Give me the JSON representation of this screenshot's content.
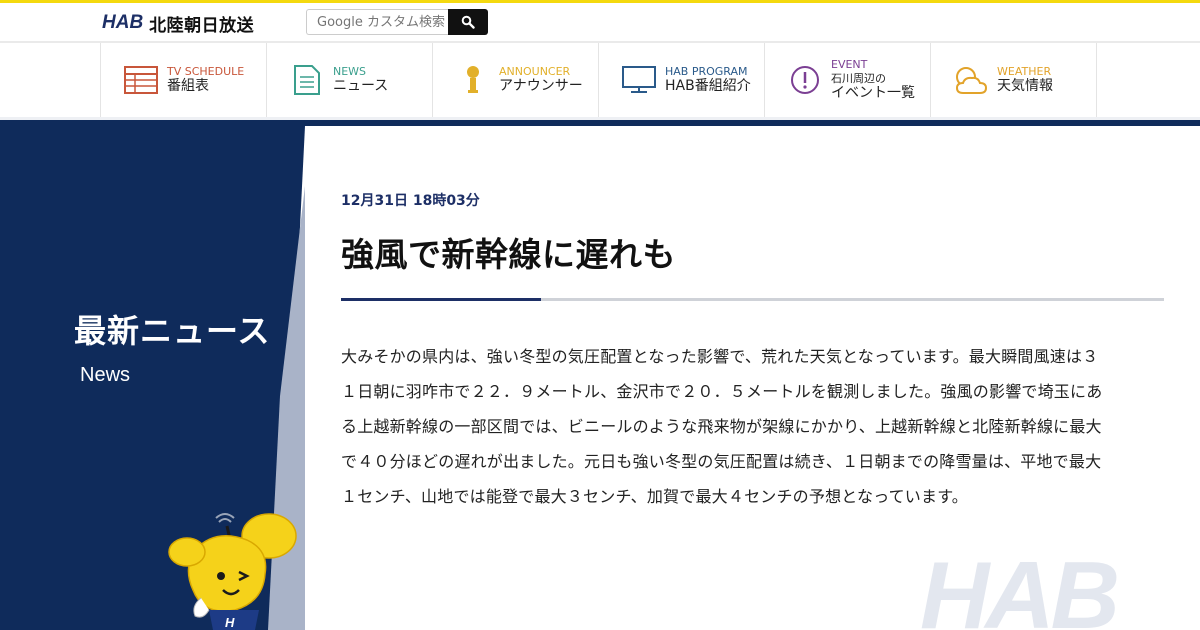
{
  "header": {
    "logo_mark": "HAB",
    "logo_text": "北陸朝日放送",
    "search_placeholder": "Google カスタム検索"
  },
  "nav": [
    {
      "en": "TV SCHEDULE",
      "ja": "番組表",
      "icon": "tv-schedule-icon",
      "color": "#c8563a"
    },
    {
      "en": "NEWS",
      "ja": "ニュース",
      "icon": "news-icon",
      "color": "#3a9f8d"
    },
    {
      "en": "ANNOUNCER",
      "ja": "アナウンサー",
      "icon": "announcer-icon",
      "color": "#e2b02a"
    },
    {
      "en": "HAB PROGRAM",
      "ja": "HAB番組紹介",
      "icon": "tv-monitor-icon",
      "color": "#2a5a8a"
    },
    {
      "en": "EVENT",
      "ja_line1": "石川周辺の",
      "ja_line2": "イベント一覧",
      "icon": "exclamation-icon",
      "color": "#7b3f93"
    },
    {
      "en": "WEATHER",
      "ja": "天気情報",
      "icon": "weather-icon",
      "color": "#e2a32a"
    }
  ],
  "sidebar": {
    "title": "最新ニュース",
    "subtitle": "News"
  },
  "article": {
    "date": "12月31日 18時03分",
    "title": "強風で新幹線に遅れも",
    "body": "大みそかの県内は、強い冬型の気圧配置となった影響で、荒れた天気となっています。最大瞬間風速は３１日朝に羽咋市で２２．９メートル、金沢市で２０．５メートルを観測しました。強風の影響で埼玉にある上越新幹線の一部区間では、ビニールのような飛来物が架線にかかり、上越新幹線と北陸新幹線に最大で４０分ほどの遅れが出ました。元日も強い冬型の気圧配置は続き、１日朝までの降雪量は、平地で最大１センチ、山地では能登で最大３センチ、加賀で最大４センチの予想となっています。"
  },
  "colors": {
    "navy": "#0f2b5b",
    "accent_yellow": "#f4d90f",
    "title_accent": "#1d2f66"
  }
}
